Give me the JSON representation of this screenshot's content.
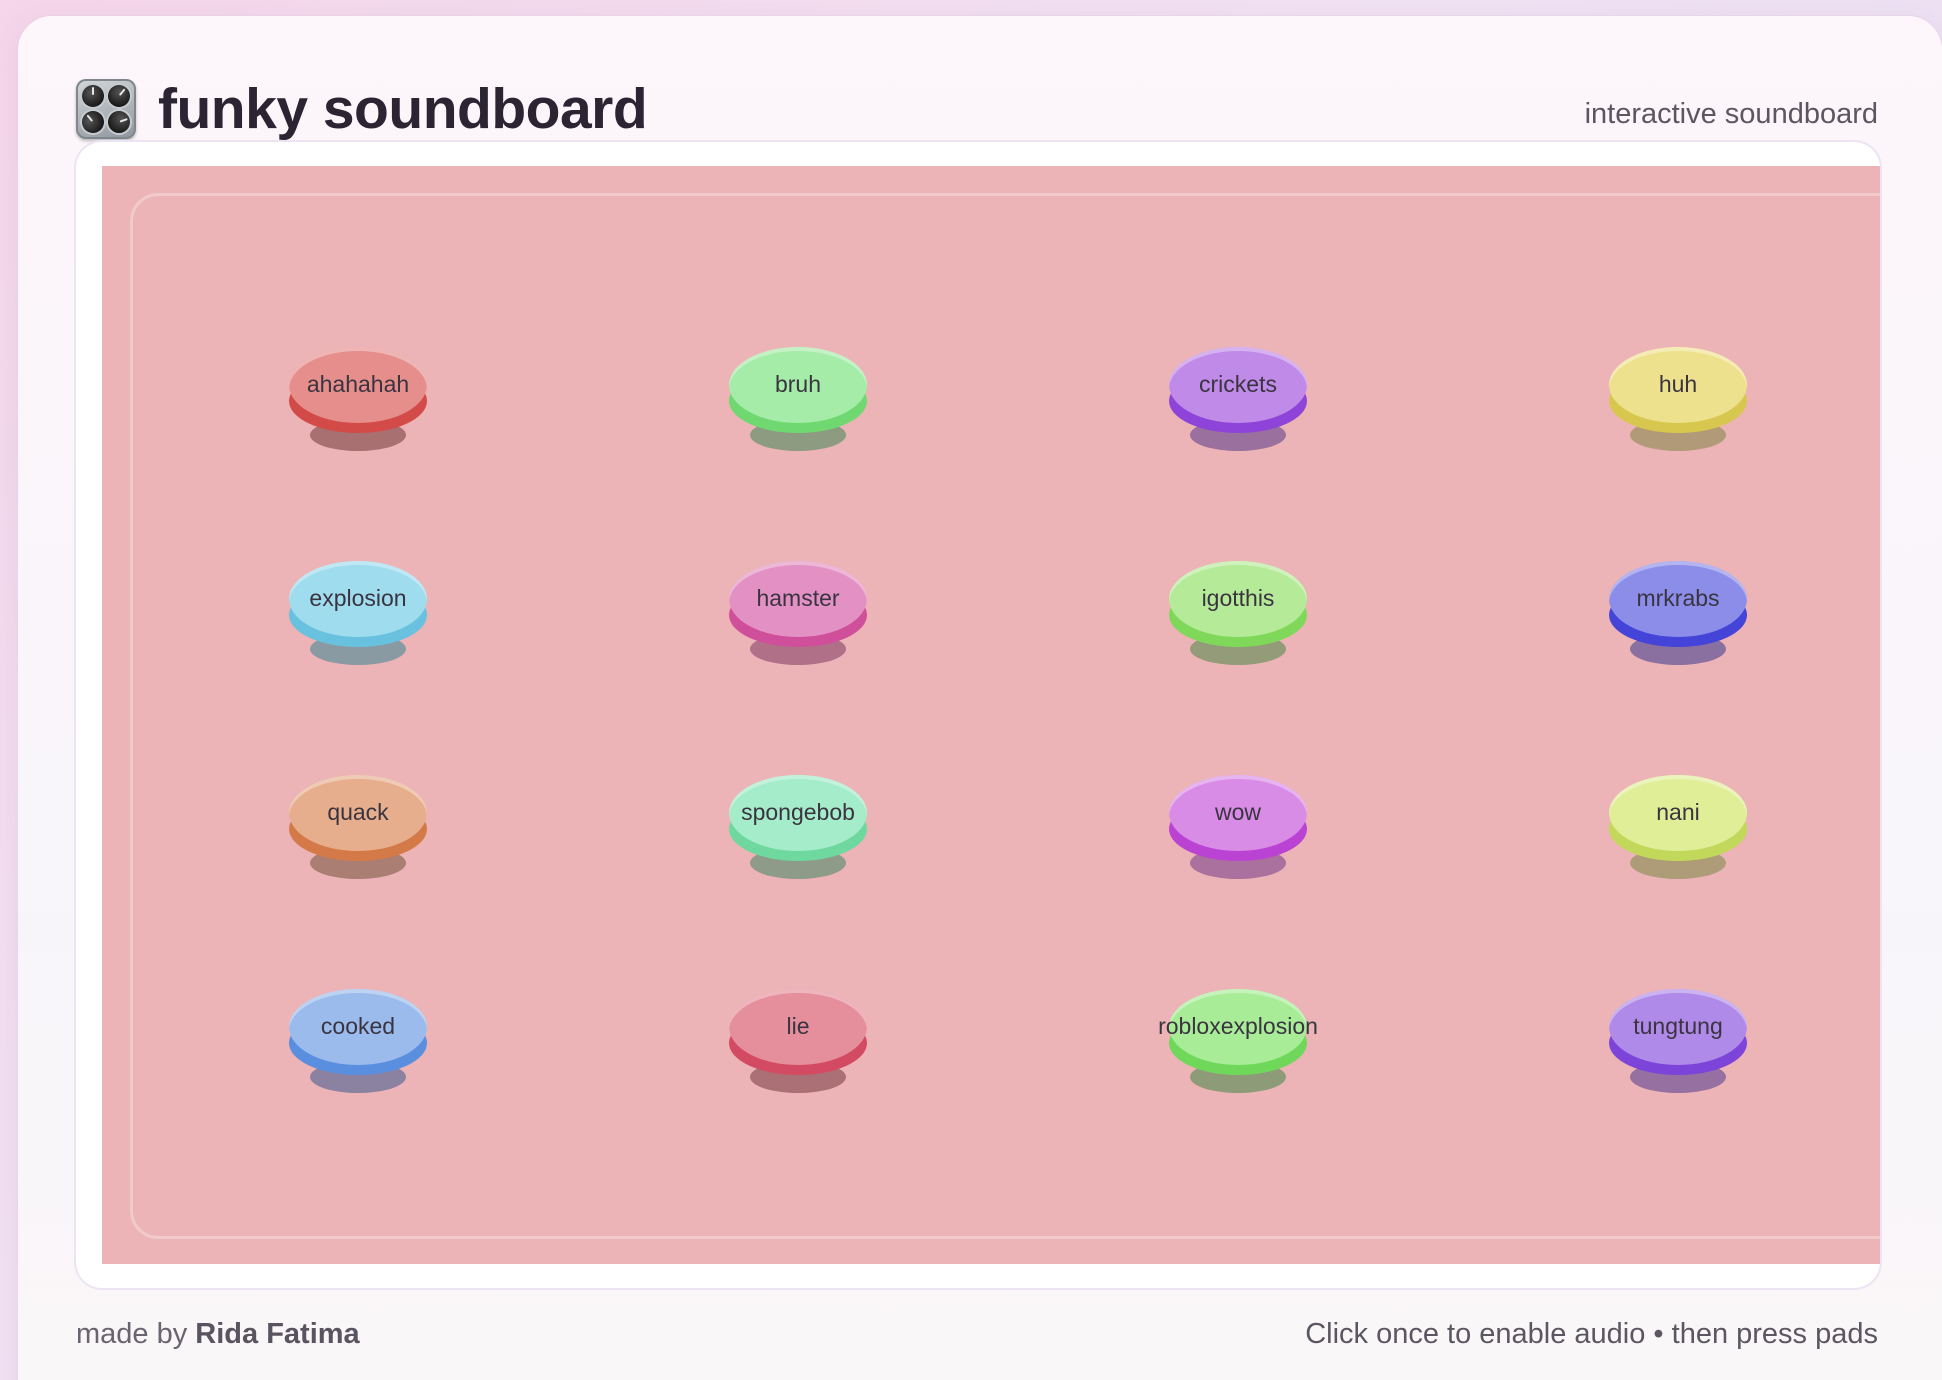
{
  "app": {
    "title": "funky soundboard",
    "subtitle": "interactive soundboard",
    "icon": "control-knobs-icon"
  },
  "board": {
    "background": "#ecb4b6",
    "pads": [
      {
        "label": "ahahahah",
        "top": "#e58e8c",
        "base": "#d34b49",
        "shadow": "#a87070"
      },
      {
        "label": "bruh",
        "top": "#a5eca8",
        "base": "#6fd871",
        "shadow": "#8d9b80"
      },
      {
        "label": "crickets",
        "top": "#c08ae8",
        "base": "#8e44d8",
        "shadow": "#9a709e"
      },
      {
        "label": "huh",
        "top": "#eee18e",
        "base": "#d8c74e",
        "shadow": "#b19a78"
      },
      {
        "label": "explosion",
        "top": "#9fdcee",
        "base": "#68c1de",
        "shadow": "#8a9aa2"
      },
      {
        "label": "hamster",
        "top": "#e391c4",
        "base": "#cf4f9a",
        "shadow": "#b07088"
      },
      {
        "label": "igotthis",
        "top": "#b5eb98",
        "base": "#80d85a",
        "shadow": "#939b78"
      },
      {
        "label": "mrkrabs",
        "top": "#8b8de8",
        "base": "#4444d8",
        "shadow": "#8a70a0"
      },
      {
        "label": "quack",
        "top": "#e6ae8c",
        "base": "#d47a48",
        "shadow": "#ab7e74"
      },
      {
        "label": "spongebob",
        "top": "#a4ecca",
        "base": "#6fd89f",
        "shadow": "#8d9b88"
      },
      {
        "label": "wow",
        "top": "#d98ce6",
        "base": "#bb43d4",
        "shadow": "#aa709e"
      },
      {
        "label": "nani",
        "top": "#e1ee98",
        "base": "#c2d85a",
        "shadow": "#ae9c78"
      },
      {
        "label": "cooked",
        "top": "#9bbbec",
        "base": "#5a8ede",
        "shadow": "#8a82a0"
      },
      {
        "label": "lie",
        "top": "#e58e9c",
        "base": "#d34b62",
        "shadow": "#ab7076"
      },
      {
        "label": "robloxexplosion",
        "top": "#a8ec98",
        "base": "#6fd85a",
        "shadow": "#8d9b78"
      },
      {
        "label": "tungtung",
        "top": "#b08ae8",
        "base": "#7c44d8",
        "shadow": "#9570a0"
      }
    ]
  },
  "footer": {
    "made_by_prefix": "made by ",
    "author": "Rida Fatima",
    "hint": "Click once to enable audio • then press pads"
  }
}
